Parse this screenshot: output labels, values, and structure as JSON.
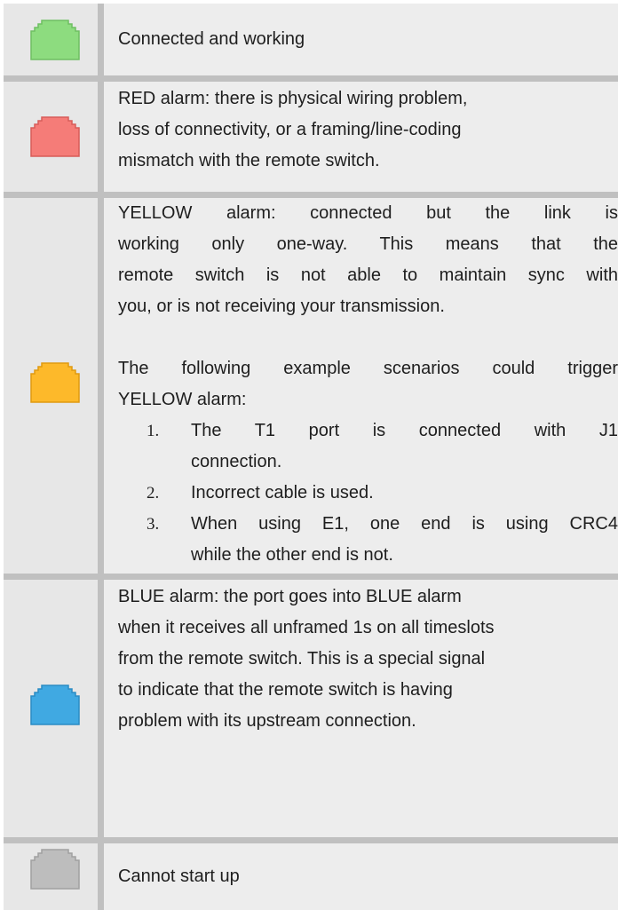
{
  "rows": [
    {
      "icon": "port-green-icon",
      "color": "#8ddc7f",
      "text": "Connected and working"
    },
    {
      "icon": "port-red-icon",
      "color": "#f57c78",
      "lines": [
        "RED alarm: there is physical wiring problem,",
        "loss of connectivity, or a framing/line-coding",
        "mismatch with the remote switch."
      ]
    },
    {
      "icon": "port-yellow-icon",
      "color": "#fdb92a",
      "lines": [
        "YELLOW alarm: connected but the link is",
        "working only one-way. This means that the",
        "remote switch is not able to maintain sync with",
        "you, or is not receiving your transmission."
      ],
      "example_lines": [
        "The following example scenarios could trigger",
        "YELLOW alarm:"
      ],
      "scenarios": [
        {
          "num": "1.",
          "lines": [
            "The T1 port is connected with J1",
            "connection."
          ]
        },
        {
          "num": "2.",
          "lines": [
            "Incorrect cable is used."
          ]
        },
        {
          "num": "3.",
          "lines": [
            "When using E1, one end is using CRC4",
            "while the other end is not."
          ]
        }
      ]
    },
    {
      "icon": "port-blue-icon",
      "color": "#40a9e2",
      "lines": [
        "BLUE alarm: the port goes into BLUE alarm",
        "when it receives all unframed 1s on all timeslots",
        "from the remote switch. This is a special signal",
        "to indicate that the remote switch is having",
        "problem with its upstream connection."
      ]
    },
    {
      "icon": "port-gray-icon",
      "color": "#bdbdbd",
      "text": "Cannot start up"
    }
  ]
}
